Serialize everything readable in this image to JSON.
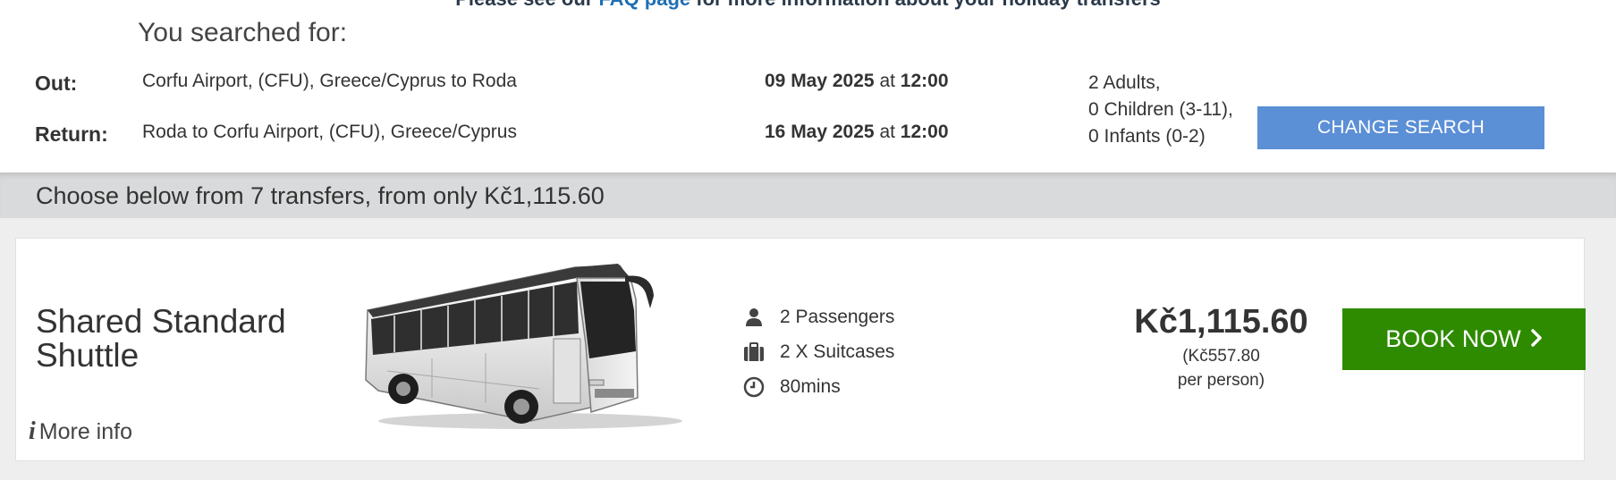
{
  "top_note": {
    "prefix": "Please see our ",
    "link": "FAQ page",
    "suffix": " for more information about your holiday transfers"
  },
  "search": {
    "title": "You searched for:",
    "out_label": "Out:",
    "return_label": "Return:",
    "out_route": "Corfu Airport, (CFU), Greece/Cyprus to Roda",
    "return_route": "Roda to Corfu Airport, (CFU), Greece/Cyprus",
    "out_date": "09 May 2025",
    "out_time": "12:00",
    "return_date": "16 May 2025",
    "return_time": "12:00",
    "at_word": " at ",
    "passengers": [
      "2 Adults,",
      "0 Children (3-11),",
      "0 Infants (0-2)"
    ],
    "change_button": "CHANGE SEARCH"
  },
  "summary": {
    "text": "Choose below from 7 transfers, from only Kč1,115.60"
  },
  "result": {
    "vehicle_name": "Shared Standard Shuttle",
    "more_info": "More info",
    "features": [
      {
        "icon": "person-icon",
        "text": "2 Passengers"
      },
      {
        "icon": "suitcase-icon",
        "text": "2 X Suitcases"
      },
      {
        "icon": "clock-icon",
        "text": "80mins"
      }
    ],
    "price": "Kč1,115.60",
    "price_per_person": "(Kč557.80",
    "per_person_label": "per person)",
    "book_button": "BOOK NOW"
  },
  "colors": {
    "change_button": "#5b8fd6",
    "book_button": "#2e8b00",
    "link": "#1f6fb5",
    "summary_bar": "#d9dadb"
  }
}
